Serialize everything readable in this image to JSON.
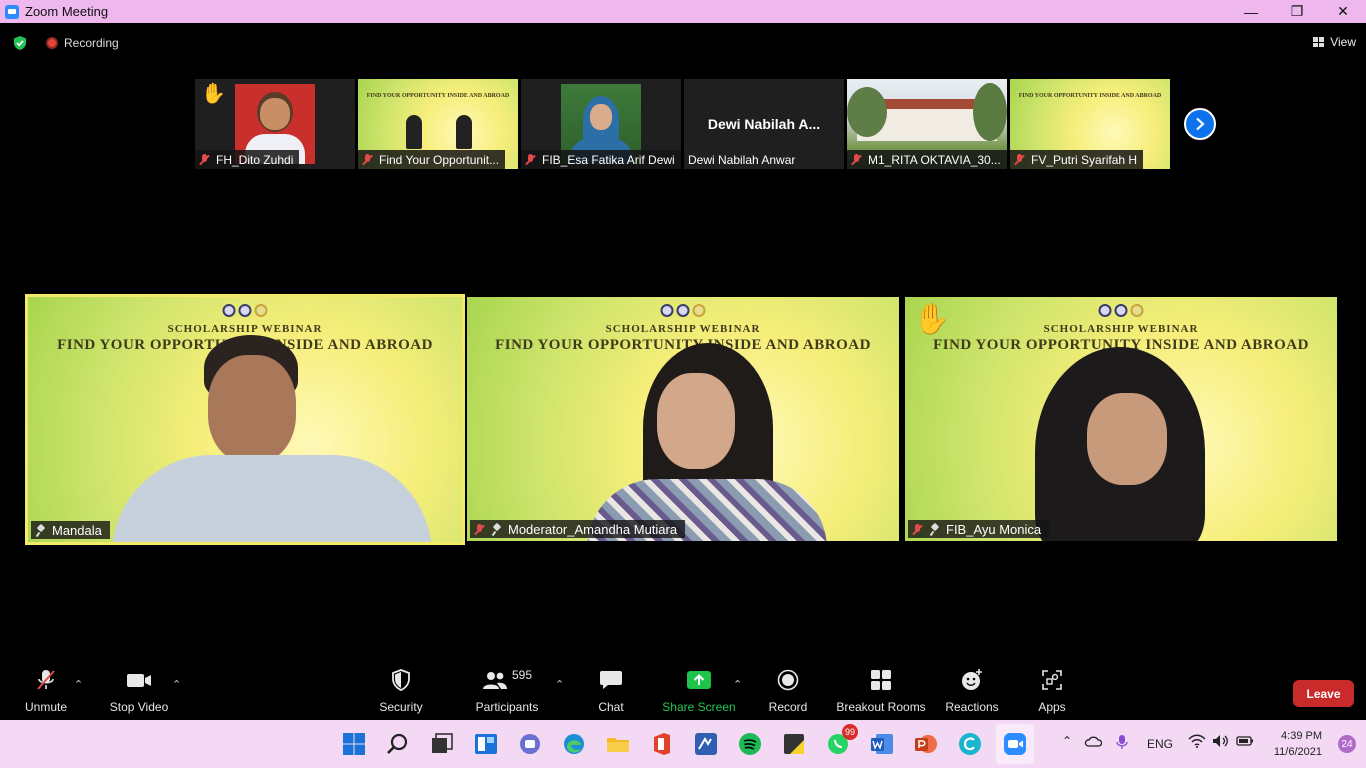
{
  "window": {
    "title": "Zoom Meeting"
  },
  "topbar": {
    "recording": "Recording",
    "view": "View"
  },
  "thumbnails": [
    {
      "name": "FH_Dito Zuhdi",
      "muted": true,
      "hand_raised": true
    },
    {
      "name": "Find Your Opportunit...",
      "muted": true
    },
    {
      "name": "FIB_Esa Fatika Arif Dewi",
      "muted": true
    },
    {
      "name": "Dewi Nabilah Anwar",
      "muted": false,
      "avatar_text": "Dewi Nabilah A..."
    },
    {
      "name": "M1_RITA OKTAVIA_30...",
      "muted": true
    },
    {
      "name": "FV_Putri Syarifah H",
      "muted": true
    }
  ],
  "banner": {
    "line1": "SCHOLARSHIP WEBINAR",
    "line2": "FIND YOUR OPPORTUNITY INSIDE AND ABROAD"
  },
  "tiles": [
    {
      "name": "Mandala",
      "active": true,
      "muted": false
    },
    {
      "name": "Moderator_Amandha Mutiara",
      "muted": true
    },
    {
      "name": "FIB_Ayu Monica",
      "muted": true,
      "hand_raised": true
    }
  ],
  "toolbar": {
    "unmute": "Unmute",
    "stop_video": "Stop Video",
    "security": "Security",
    "participants": "Participants",
    "participant_count": "595",
    "chat": "Chat",
    "share_screen": "Share Screen",
    "record": "Record",
    "breakout_rooms": "Breakout Rooms",
    "reactions": "Reactions",
    "apps": "Apps",
    "leave": "Leave"
  },
  "taskbar": {
    "whatsapp_badge": "99",
    "language": "ENG",
    "time": "4:39 PM",
    "date": "11/6/2021",
    "notifications": "24"
  },
  "colors": {
    "zoom_blue": "#0e72ed",
    "share_green": "#1fc24a",
    "leave_red": "#c92a2a",
    "title_bar": "#eeb7ee"
  }
}
